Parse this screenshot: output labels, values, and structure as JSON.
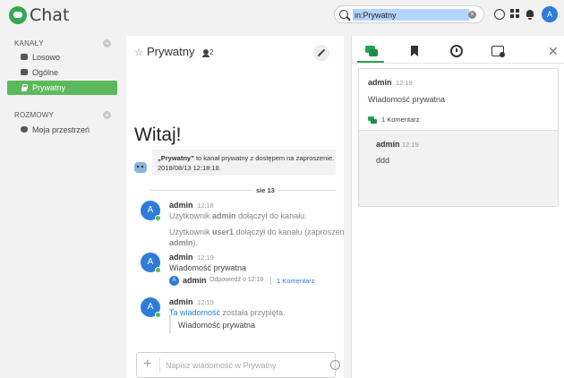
{
  "app": {
    "title": "Chat"
  },
  "search": {
    "value": "in:Prywatny"
  },
  "user": {
    "avatar_letter": "A"
  },
  "sidebar": {
    "channels_title": "KANAŁY",
    "channels": [
      {
        "label": "Losowo",
        "icon": "chat-icon"
      },
      {
        "label": "Ogólne",
        "icon": "chat-icon"
      },
      {
        "label": "Prywatny",
        "icon": "lock-icon"
      }
    ],
    "conversations_title": "ROZMOWY",
    "conversations": [
      {
        "label": "Moja przestrzeń",
        "icon": "heart-icon"
      }
    ]
  },
  "room": {
    "name": "Prywatny",
    "users_count": "2",
    "welcome": "Witaj!",
    "intro_name": "„Prywatny”",
    "intro_text": " to kanał prywatny z dostępem na zaproszenie. Zosta",
    "intro_date": "2018/08/13 12:18:18.",
    "day_divider": "sie 13"
  },
  "messages": {
    "m1": {
      "avatar": "A",
      "user": "admin",
      "time": "12:18",
      "sys1_prefix": "Użytkownik ",
      "sys1_name": "admin",
      "sys1_suffix": " dołączył do kanału.",
      "sys2_prefix": "Użytkownik ",
      "sys2_name": "user1",
      "sys2_suffix": " dołączył do kanału (zaproszenie",
      "sys2_line2_name": "admin",
      "sys2_line2_suffix": ")."
    },
    "m2": {
      "avatar": "A",
      "user": "admin",
      "time": "12:19",
      "text": "Wiadomość prywatna",
      "thread_avatar": "A",
      "thread_user": "admin",
      "thread_reply": "Odpowiedź o 12:19",
      "thread_link": "1 Komentarz"
    },
    "m3": {
      "avatar": "A",
      "user": "admin",
      "time": "12:19",
      "pin_link": "Ta wiadomość",
      "pin_suffix": " została przypięta.",
      "quote": "Wiadomość prywatna"
    }
  },
  "composer": {
    "placeholder": "Napisz wiadomość w Prywatny"
  },
  "panel": {
    "close": "✕",
    "thread": {
      "user": "admin",
      "time": "12:19",
      "text": "Wiadomość prywatna",
      "comments": "1 Komentarz",
      "reply": {
        "user": "admin",
        "time": "12:19",
        "text": "ddd"
      }
    }
  },
  "colors": {
    "accent": "#5cb85c",
    "link": "#2f7bd9",
    "avatar": "#2f7bd9"
  }
}
